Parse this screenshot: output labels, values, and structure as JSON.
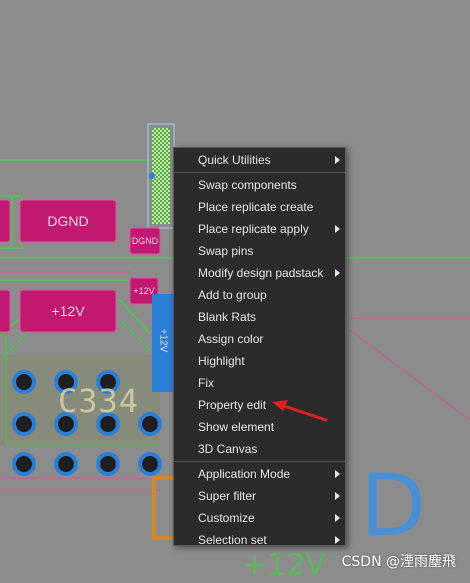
{
  "colors": {
    "board": "#8c8c8c",
    "pad_magenta": "#c2186f",
    "trace_green": "#5cb85c",
    "via_blue": "#2b7fd6",
    "menu_bg": "#2b2b2b",
    "annotation_red": "#e02020"
  },
  "pcb": {
    "pad_labels": [
      "DGND",
      "DGND",
      "+12V",
      "+12V"
    ],
    "rotated_label": "+12V",
    "silkscreen": "C334",
    "ghost_text": "D",
    "bottom_ghost_text": "+12V"
  },
  "context_menu": {
    "sections": [
      [
        {
          "label": "Quick Utilities",
          "submenu": true
        }
      ],
      [
        {
          "label": "Swap components",
          "submenu": false
        },
        {
          "label": "Place replicate create",
          "submenu": false
        },
        {
          "label": "Place replicate apply",
          "submenu": true
        },
        {
          "label": "Swap pins",
          "submenu": false
        },
        {
          "label": "Modify design padstack",
          "submenu": true
        },
        {
          "label": "Add to group",
          "submenu": false
        },
        {
          "label": "Blank Rats",
          "submenu": false
        },
        {
          "label": "Assign color",
          "submenu": false
        },
        {
          "label": "Highlight",
          "submenu": false
        },
        {
          "label": "Fix",
          "submenu": false
        },
        {
          "label": "Property edit",
          "submenu": false
        },
        {
          "label": "Show element",
          "submenu": false
        },
        {
          "label": "3D Canvas",
          "submenu": false
        }
      ],
      [
        {
          "label": "Application Mode",
          "submenu": true
        },
        {
          "label": "Super filter",
          "submenu": true
        },
        {
          "label": "Customize",
          "submenu": true
        },
        {
          "label": "Selection set",
          "submenu": true
        }
      ]
    ]
  },
  "watermark": "CSDN @湮雨塵飛"
}
